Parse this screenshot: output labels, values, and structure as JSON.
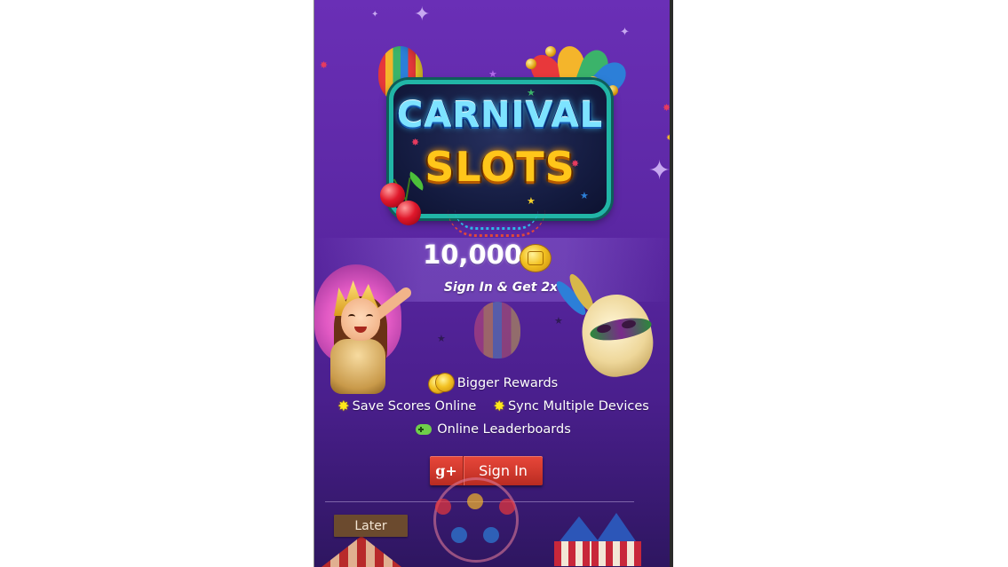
{
  "game": {
    "logo_line_1": "CARNIVAL",
    "logo_line_2": "SLOTS",
    "bonus_amount": "10,000",
    "signin_tagline": "Sign In & Get 2x",
    "features": {
      "bigger_rewards": "Bigger Rewards",
      "save_scores": "Save Scores Online",
      "sync_devices": "Sync Multiple Devices",
      "leaderboards": "Online Leaderboards"
    },
    "signin_button": {
      "provider_glyph": "g+",
      "label": "Sign In"
    },
    "later_button": "Later"
  },
  "icons": {
    "coin": "coin-icon",
    "star": "star-icon",
    "gamepad": "gamepad-icon",
    "google_plus": "google-plus-icon"
  },
  "colors": {
    "background_top": "#6a2fb6",
    "background_bottom": "#2e1660",
    "signin_button": "#d23a2e",
    "later_button": "#6b4a2e",
    "feature_star": "#ffe81a",
    "gamepad": "#6fcf4a",
    "logo_border": "#21b5a6"
  }
}
